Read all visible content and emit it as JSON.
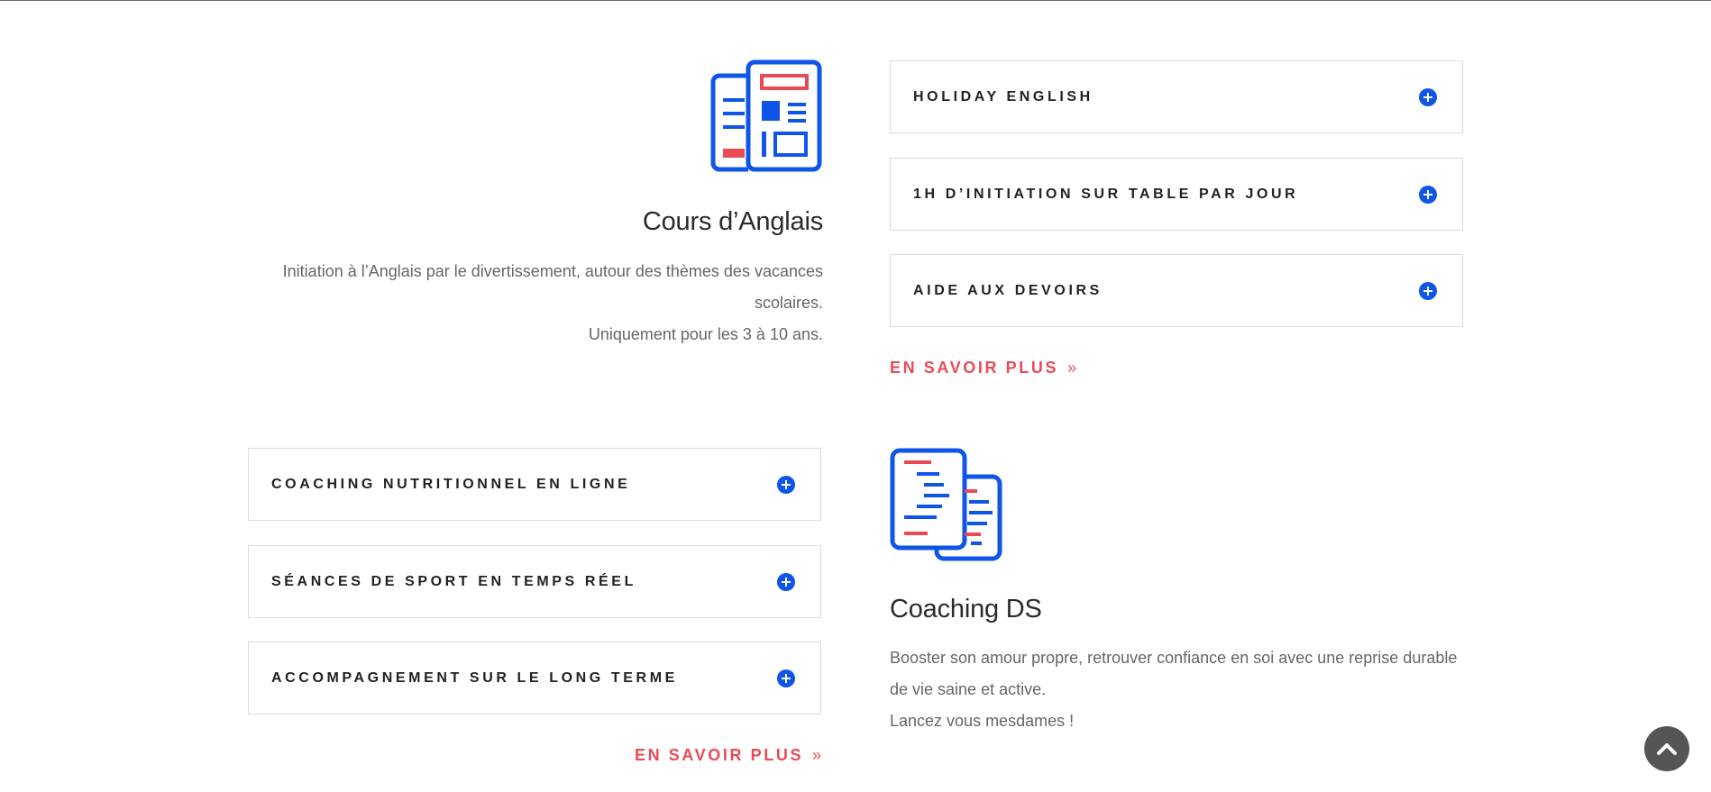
{
  "section_english": {
    "icon": "newspaper-icon",
    "title": "Cours d’Anglais",
    "description_line1": "Initiation à l’Anglais par le divertissement, autour des thèmes des vacances scolaires.",
    "description_line2": "Uniquement pour les 3 à 10 ans.",
    "accordion": [
      {
        "label": "HOLIDAY ENGLISH"
      },
      {
        "label": "1H D’INITIATION SUR TABLE PAR JOUR"
      },
      {
        "label": "AIDE AUX DEVOIRS"
      }
    ],
    "more_link": "EN SAVOIR PLUS",
    "more_chevron": "»"
  },
  "section_coaching": {
    "icon": "documents-icon",
    "title": "Coaching DS",
    "description_line1": "Booster son amour propre, retrouver confiance en soi avec une reprise durable de vie saine et active.",
    "description_line2": "Lancez vous mesdames !",
    "accordion": [
      {
        "label": "COACHING NUTRITIONNEL EN LIGNE"
      },
      {
        "label": "SÉANCES DE SPORT EN TEMPS RÉEL"
      },
      {
        "label": "ACCOMPAGNEMENT SUR LE LONG TERME"
      }
    ],
    "more_link": "EN SAVOIR PLUS",
    "more_chevron": "»"
  },
  "scroll_top": {
    "icon": "chevron-up-icon"
  },
  "colors": {
    "accent_blue": "#0f55e8",
    "accent_red": "#e94b55",
    "text_dark": "#2b2b2b",
    "text_muted": "#666666",
    "border": "#dcdcdc"
  }
}
